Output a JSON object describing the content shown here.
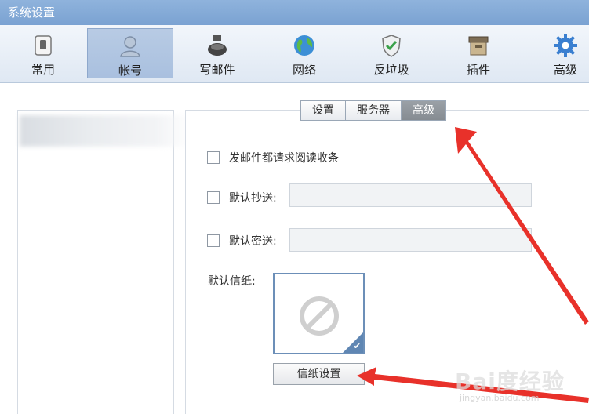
{
  "window": {
    "title": "系统设置"
  },
  "toolbar": {
    "items": [
      {
        "label": "常用",
        "icon": "switch-icon"
      },
      {
        "label": "帐号",
        "icon": "user-icon",
        "active": true
      },
      {
        "label": "写邮件",
        "icon": "ink-bottle-icon"
      },
      {
        "label": "网络",
        "icon": "globe-icon"
      },
      {
        "label": "反垃圾",
        "icon": "shield-check-icon"
      },
      {
        "label": "插件",
        "icon": "box-icon"
      },
      {
        "label": "高级",
        "icon": "gear-icon"
      }
    ]
  },
  "tabs": [
    {
      "label": "设置"
    },
    {
      "label": "服务器"
    },
    {
      "label": "高级",
      "active": true
    }
  ],
  "advanced": {
    "read_receipt_label": "发邮件都请求阅读收条",
    "default_cc_label": "默认抄送:",
    "default_cc_value": "",
    "default_bcc_label": "默认密送:",
    "default_bcc_value": "",
    "stationery_label": "默认信纸:",
    "stationery_button": "信纸设置"
  },
  "watermark": {
    "text": "Bai度经验",
    "url": "jingyan.baidu.com"
  },
  "colors": {
    "arrow": "#e8312a",
    "titlebar": "#7aa2d2",
    "active_tab": "#868c92"
  }
}
